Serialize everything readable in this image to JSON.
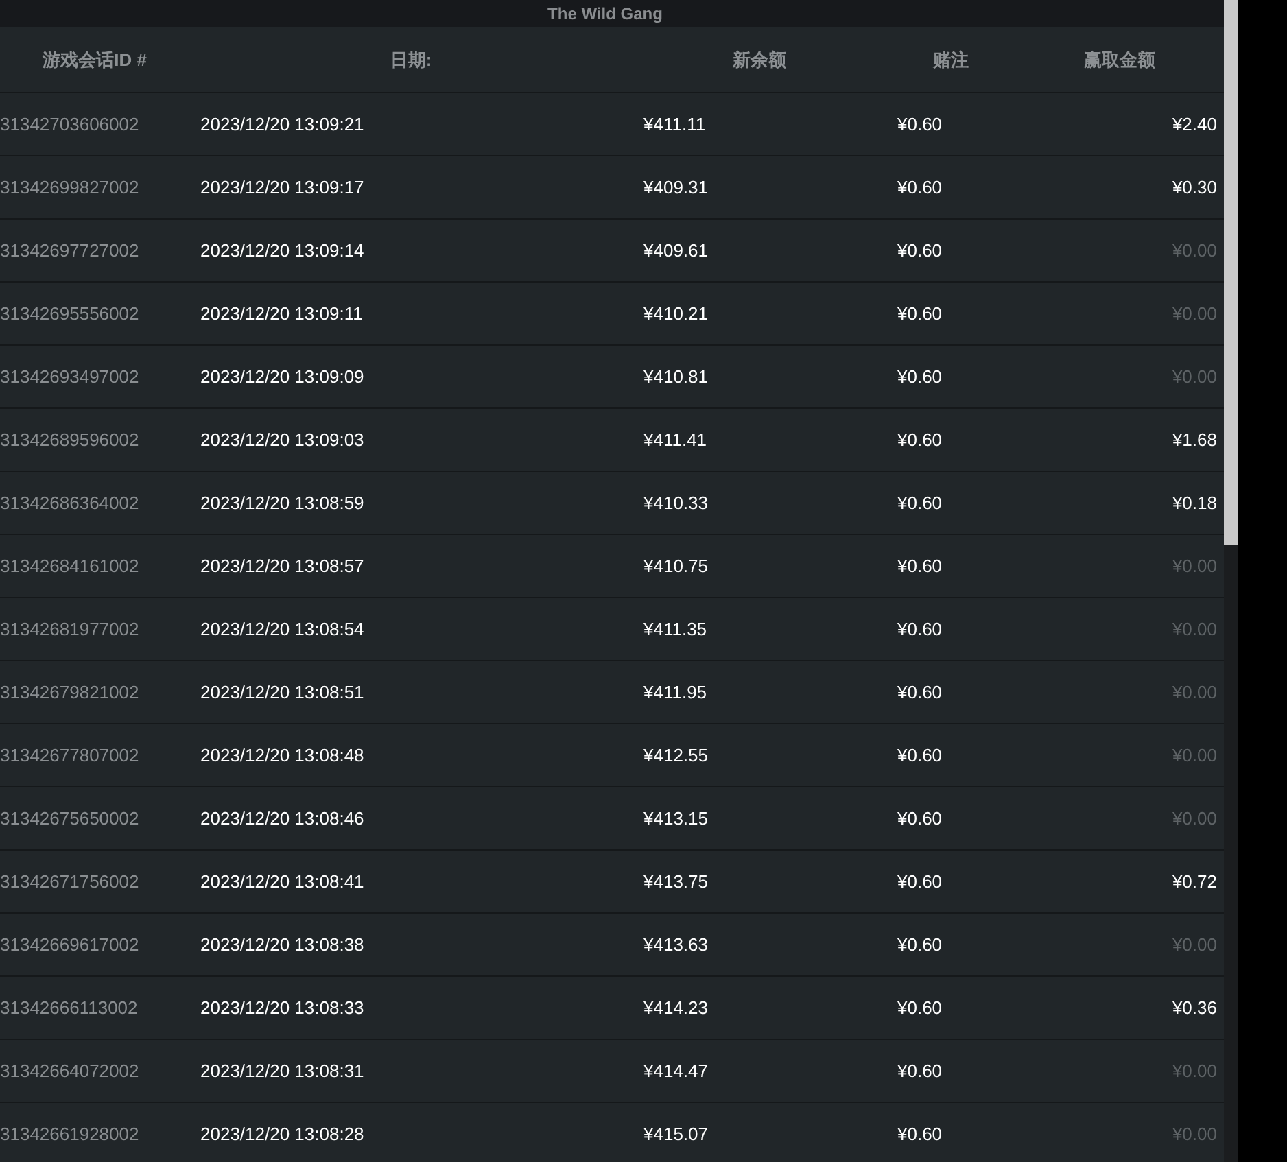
{
  "title": "The Wild Gang",
  "table": {
    "columns": [
      "游戏会话ID #",
      "日期:",
      "新余额",
      "赌注",
      "赢取金额"
    ],
    "rows": [
      {
        "id": "31342703606002",
        "date": "2023/12/20 13:09:21",
        "balance": "¥411.11",
        "bet": "¥0.60",
        "win": "¥2.40",
        "dimmed": false
      },
      {
        "id": "31342699827002",
        "date": "2023/12/20 13:09:17",
        "balance": "¥409.31",
        "bet": "¥0.60",
        "win": "¥0.30",
        "dimmed": false
      },
      {
        "id": "31342697727002",
        "date": "2023/12/20 13:09:14",
        "balance": "¥409.61",
        "bet": "¥0.60",
        "win": "¥0.00",
        "dimmed": true
      },
      {
        "id": "31342695556002",
        "date": "2023/12/20 13:09:11",
        "balance": "¥410.21",
        "bet": "¥0.60",
        "win": "¥0.00",
        "dimmed": true
      },
      {
        "id": "31342693497002",
        "date": "2023/12/20 13:09:09",
        "balance": "¥410.81",
        "bet": "¥0.60",
        "win": "¥0.00",
        "dimmed": true
      },
      {
        "id": "31342689596002",
        "date": "2023/12/20 13:09:03",
        "balance": "¥411.41",
        "bet": "¥0.60",
        "win": "¥1.68",
        "dimmed": false
      },
      {
        "id": "31342686364002",
        "date": "2023/12/20 13:08:59",
        "balance": "¥410.33",
        "bet": "¥0.60",
        "win": "¥0.18",
        "dimmed": false
      },
      {
        "id": "31342684161002",
        "date": "2023/12/20 13:08:57",
        "balance": "¥410.75",
        "bet": "¥0.60",
        "win": "¥0.00",
        "dimmed": true
      },
      {
        "id": "31342681977002",
        "date": "2023/12/20 13:08:54",
        "balance": "¥411.35",
        "bet": "¥0.60",
        "win": "¥0.00",
        "dimmed": true
      },
      {
        "id": "31342679821002",
        "date": "2023/12/20 13:08:51",
        "balance": "¥411.95",
        "bet": "¥0.60",
        "win": "¥0.00",
        "dimmed": true
      },
      {
        "id": "31342677807002",
        "date": "2023/12/20 13:08:48",
        "balance": "¥412.55",
        "bet": "¥0.60",
        "win": "¥0.00",
        "dimmed": true
      },
      {
        "id": "31342675650002",
        "date": "2023/12/20 13:08:46",
        "balance": "¥413.15",
        "bet": "¥0.60",
        "win": "¥0.00",
        "dimmed": true
      },
      {
        "id": "31342671756002",
        "date": "2023/12/20 13:08:41",
        "balance": "¥413.75",
        "bet": "¥0.60",
        "win": "¥0.72",
        "dimmed": false
      },
      {
        "id": "31342669617002",
        "date": "2023/12/20 13:08:38",
        "balance": "¥413.63",
        "bet": "¥0.60",
        "win": "¥0.00",
        "dimmed": true
      },
      {
        "id": "31342666113002",
        "date": "2023/12/20 13:08:33",
        "balance": "¥414.23",
        "bet": "¥0.60",
        "win": "¥0.36",
        "dimmed": false
      },
      {
        "id": "31342664072002",
        "date": "2023/12/20 13:08:31",
        "balance": "¥414.47",
        "bet": "¥0.60",
        "win": "¥0.00",
        "dimmed": true
      },
      {
        "id": "31342661928002",
        "date": "2023/12/20 13:08:28",
        "balance": "¥415.07",
        "bet": "¥0.60",
        "win": "¥0.00",
        "dimmed": true
      }
    ]
  }
}
